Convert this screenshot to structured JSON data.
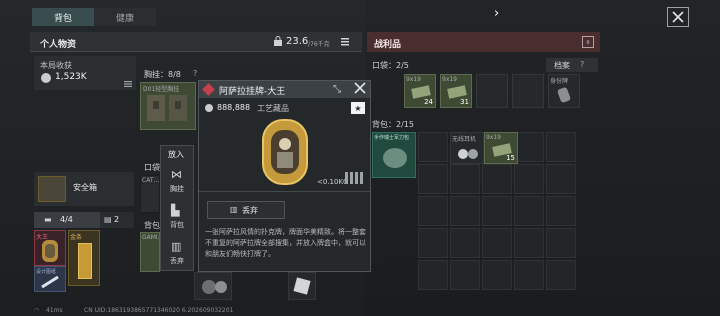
{
  "top_tabs": [
    {
      "label": "背包"
    },
    {
      "label": "健康"
    }
  ],
  "nav": {
    "arrow": "›"
  },
  "left": {
    "title": "个人物资",
    "weight": "23.6",
    "weight_max": "/76千克",
    "income_label": "本局收获",
    "income_value": "1,523K",
    "chest_label": "胸挂：8/8",
    "chest_help": "?",
    "chest_item": "D01轻型胸挂",
    "pocket_label": "口袋",
    "backpack_label": "背包",
    "backpack_item": "GAMI…",
    "cat_item": "CAT…",
    "safe_label": "安全箱",
    "key_count": "4/4",
    "case_count": "2",
    "tiny_tag1": "大王",
    "tiny_tag2": "金条",
    "tiny_tag3": "设计图纸"
  },
  "menu": {
    "header": "放入",
    "items": [
      "胸挂",
      "背包",
      "丢弃"
    ]
  },
  "card": {
    "title": "阿萨拉挂牌-大王",
    "price": "888,888",
    "category": "工艺藏品",
    "weight": "<0.10KG",
    "discard": "丢弃",
    "desc": "一张阿萨拉风情的扑克牌，牌面华美精致。将一整套不重复的阿萨拉牌全部搜集，并放入牌盒中，就可以和朋友们畅快打牌了。"
  },
  "right": {
    "title": "战利品",
    "pocket_label": "口袋：2/5",
    "archive_label": "档案",
    "archive_help": "?",
    "bag_label": "背包：2/15",
    "ammo1_name": "9x19",
    "ammo1_count": "24",
    "ammo2_name": "9x19",
    "ammo2_count": "31",
    "tag_item": "身份牌",
    "bag_item1": "手作瑞士军刀包",
    "bag_item2": "无线耳机",
    "bag_item3": "9x19",
    "bag_item3_count": "15"
  },
  "footer": {
    "ping": "41ms",
    "uid": "CN UID:1863193865771346020 6.202609032201"
  }
}
